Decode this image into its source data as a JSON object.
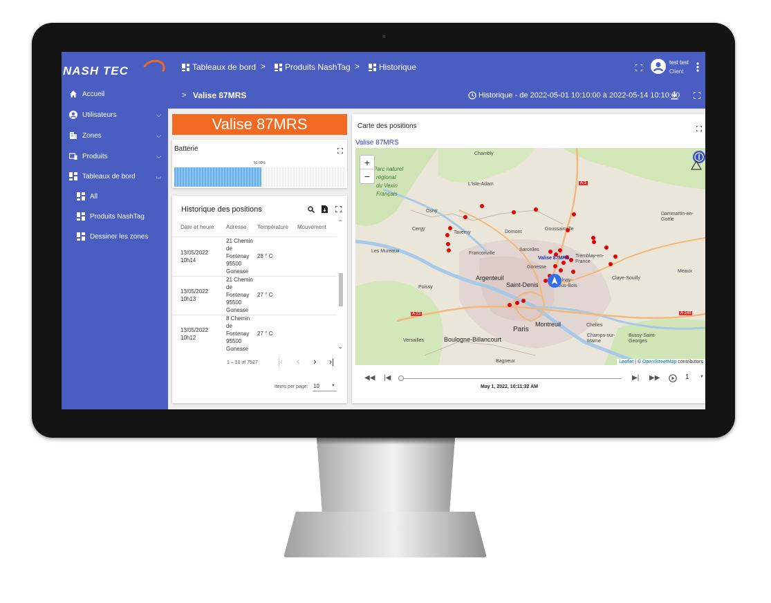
{
  "app": {
    "logo_text": "NASH TEC",
    "accent_color": "#4a5ec2",
    "orange_color": "#f26a21"
  },
  "sidebar": {
    "items": [
      {
        "label": "Accueil",
        "icon": "home-icon"
      },
      {
        "label": "Utilisateurs",
        "icon": "account-circle-icon",
        "expandable": true
      },
      {
        "label": "Zones",
        "icon": "building-icon",
        "expandable": true
      },
      {
        "label": "Produits",
        "icon": "devices-icon",
        "expandable": true
      },
      {
        "label": "Tableaux de bord",
        "icon": "dashboard-icon",
        "expanded": true
      }
    ],
    "subitems": [
      {
        "label": "All",
        "icon": "dashboard-icon"
      },
      {
        "label": "Produits NashTag",
        "icon": "dashboard-icon"
      },
      {
        "label": "Dessiner les zones",
        "icon": "dashboard-icon"
      }
    ]
  },
  "header": {
    "breadcrumbs": [
      "Tableaux de bord",
      "Produits NashTag",
      "Historique"
    ],
    "separator": ">",
    "user_name": "test test",
    "user_role": "Client"
  },
  "subheader": {
    "prefix": ">",
    "title": "Valise 87MRS",
    "history_range": "Historique - de 2022-05-01 10:10:00 à 2022-05-14 10:10:00"
  },
  "banner": {
    "title": "Valise 87MRS"
  },
  "battery": {
    "title": "Batterie",
    "percent_label": "51.00%",
    "level": 0.51
  },
  "history": {
    "title": "Historique des positions",
    "columns": [
      "Date et heure",
      "Adresse",
      "Température",
      "Mouvement"
    ],
    "rows": [
      {
        "date": "13/05/2022",
        "time": "10h14",
        "address": [
          "21 Chemin",
          "de",
          "Fontenay",
          "95500",
          "Gonesse"
        ],
        "temp": "28 ° C"
      },
      {
        "date": "13/05/2022",
        "time": "10h13",
        "address": [
          "21 Chemin",
          "de",
          "Fontenay",
          "95500",
          "Gonesse"
        ],
        "temp": "27 ° C"
      },
      {
        "date": "13/05/2022",
        "time": "10h12",
        "address": [
          "8 Chemin",
          "de",
          "Fontenay",
          "95500",
          "Gonesse"
        ],
        "temp": "27 ° C"
      }
    ],
    "range_label": "1 – 10 of 7527",
    "items_per_page_label": "Items per page:",
    "items_per_page_value": "10"
  },
  "map": {
    "title": "Carte des positions",
    "layer_label": "Valise 87MRS",
    "zoom_in": "+",
    "zoom_out": "−",
    "attribution_leaflet": "Leaflet",
    "attribution_sep": " | © ",
    "attribution_osm": "OpenStreetMap",
    "attribution_suffix": " contributors",
    "place_labels": [
      "Chambly",
      "L'Isle-Adam",
      "Parc naturel",
      "régional",
      "du Vexin",
      "Français",
      "Osny",
      "Cergy",
      "Taverny",
      "Domont",
      "Goussainville",
      "Dammartin-en-Goële",
      "Sarcelles",
      "Gonesse",
      "Tremblay-en-France",
      "Franconville",
      "Argenteuil",
      "Saint-Denis",
      "Aulnay-sous-Bois",
      "Claye-Souilly",
      "Meaux",
      "Poissy",
      "Les Mureaux",
      "Montreuil",
      "Paris",
      "Chelles",
      "Boulogne-Billancourt",
      "Versailles",
      "Bagneux",
      "Champs-sur-Marne",
      "Bussy-Saint-Georges",
      "A 1",
      "A 13",
      "A 140"
    ],
    "marker_label": "Valise 87MRS"
  },
  "player": {
    "timestamp": "May 1, 2022, 10:11:32 AM",
    "speed": "1"
  }
}
